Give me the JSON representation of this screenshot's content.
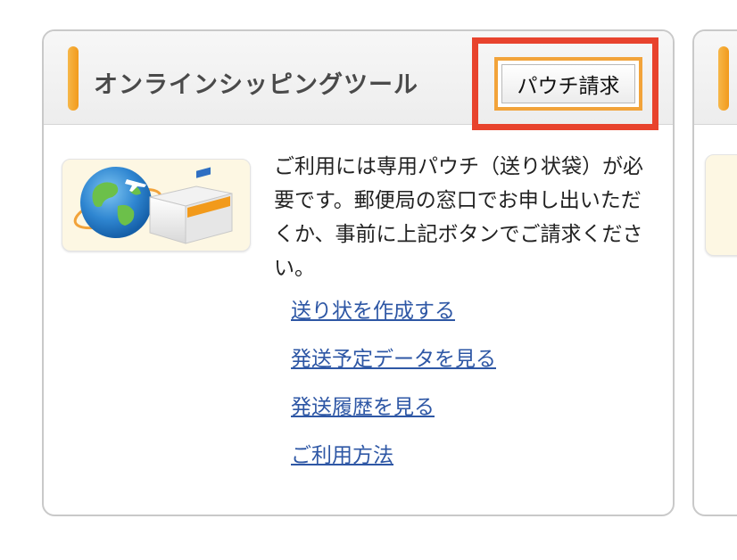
{
  "card": {
    "title": "オンラインシッピングツール",
    "pouch_button_label": "パウチ請求",
    "illustration_name": "globe-and-package-illustration",
    "description": "ご利用には専用パウチ（送り状袋）が必要です。郵便局の窓口でお申し出いただくか、事前に上記ボタンでご請求ください。",
    "links": [
      {
        "label": "送り状を作成する"
      },
      {
        "label": "発送予定データを見る"
      },
      {
        "label": "発送履歴を見る"
      },
      {
        "label": "ご利用方法"
      }
    ]
  },
  "colors": {
    "accent": "#f29a1b",
    "highlight": "#e8432d",
    "link": "#2e57a5"
  }
}
